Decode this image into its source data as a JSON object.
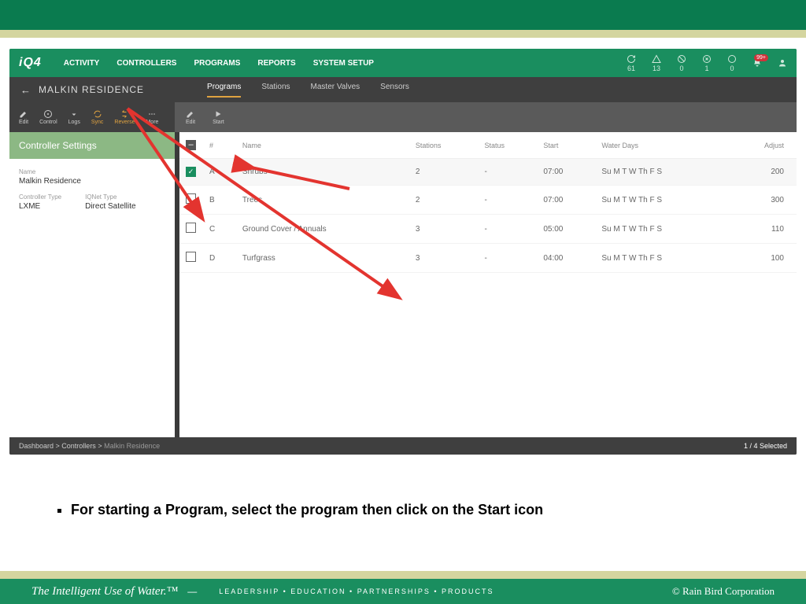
{
  "logo": "iQ4",
  "nav": {
    "activity": "ACTIVITY",
    "controllers": "CONTROLLERS",
    "programs": "PROGRAMS",
    "reports": "REPORTS",
    "setup": "SYSTEM SETUP"
  },
  "header_icons": {
    "sync": "61",
    "warn": "13",
    "stop": "0",
    "cancel": "1",
    "circle": "0",
    "bell_badge": "99+"
  },
  "page_title": "MALKIN RESIDENCE",
  "subtabs": {
    "programs": "Programs",
    "stations": "Stations",
    "master": "Master Valves",
    "sensors": "Sensors"
  },
  "left_toolbar": {
    "edit": "Edit",
    "control": "Control",
    "logs": "Logs",
    "sync": "Sync",
    "reverse": "Reverse",
    "more": "More"
  },
  "right_toolbar": {
    "edit": "Edit",
    "start": "Start"
  },
  "sidebar": {
    "heading": "Controller Settings",
    "name_label": "Name",
    "name_value": "Malkin Residence",
    "ctype_label": "Controller Type",
    "ctype_value": "LXME",
    "iq_label": "IQNet Type",
    "iq_value": "Direct Satellite"
  },
  "columns": {
    "hash": "#",
    "name": "Name",
    "stations": "Stations",
    "status": "Status",
    "start": "Start",
    "water": "Water Days",
    "adjust": "Adjust"
  },
  "rows": [
    {
      "checked": true,
      "id": "A",
      "name": "Shrubs",
      "stations": "2",
      "status": "-",
      "start": "07:00",
      "water": "Su M T W Th F S",
      "adjust": "200"
    },
    {
      "checked": false,
      "id": "B",
      "name": "Trees",
      "stations": "2",
      "status": "-",
      "start": "07:00",
      "water": "Su M T W Th F S",
      "adjust": "300"
    },
    {
      "checked": false,
      "id": "C",
      "name": "Ground Cover / Annuals",
      "stations": "3",
      "status": "-",
      "start": "05:00",
      "water": "Su M T W Th F S",
      "adjust": "110"
    },
    {
      "checked": false,
      "id": "D",
      "name": "Turfgrass",
      "stations": "3",
      "status": "-",
      "start": "04:00",
      "water": "Su M T W Th F S",
      "adjust": "100"
    }
  ],
  "breadcrumb": {
    "a": "Dashboard",
    "b": "Controllers",
    "c": "Malkin Residence",
    "sep": " > "
  },
  "selected_text": "1 / 4 Selected",
  "bullet": "For starting a Program, select the program then click on the Start icon",
  "footer": {
    "tagline": "The Intelligent Use of Water.™",
    "dash": "—",
    "words": "LEADERSHIP  •  EDUCATION  •  PARTNERSHIPS  •  PRODUCTS",
    "copy": "© Rain Bird Corporation"
  }
}
